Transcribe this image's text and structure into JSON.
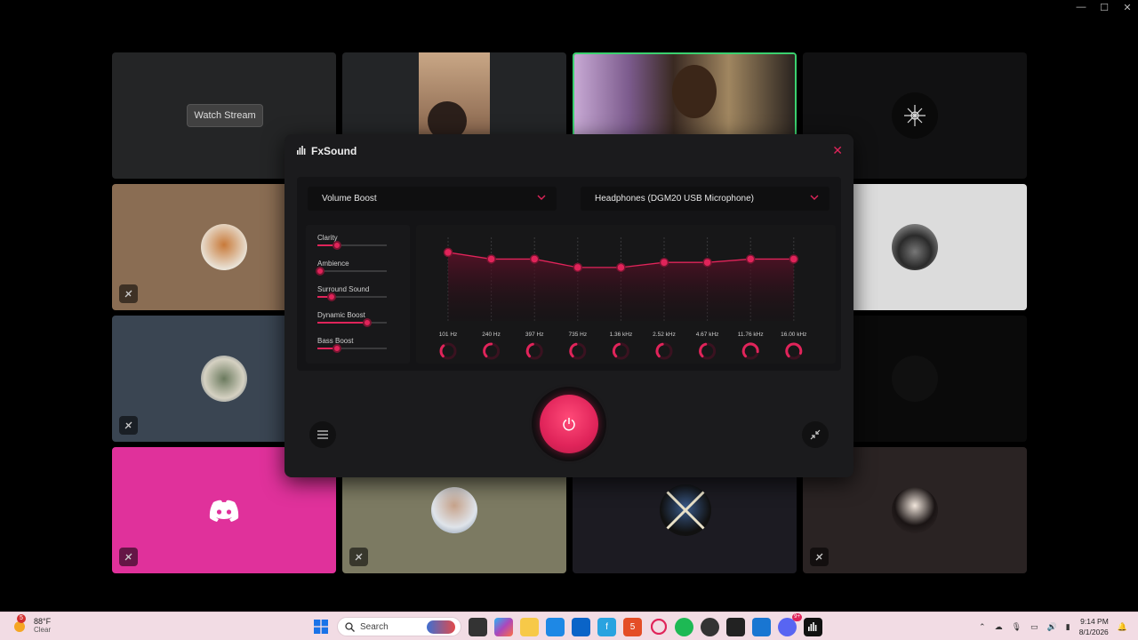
{
  "window_controls": {
    "minimize": "—",
    "maximize": "☐",
    "close": "✕"
  },
  "grid": {
    "watch_stream_label": "Watch Stream"
  },
  "fxsound": {
    "app_name": "FxSound",
    "close_icon": "close-icon",
    "preset": "Volume Boost",
    "output_device": "Headphones (DGM20 USB Microphone)",
    "effects": [
      {
        "label": "Clarity",
        "value": 0.3
      },
      {
        "label": "Ambience",
        "value": 0.0
      },
      {
        "label": "Surround Sound",
        "value": 0.2
      },
      {
        "label": "Dynamic Boost",
        "value": 0.83
      },
      {
        "label": "Bass Boost",
        "value": 0.3
      }
    ],
    "eq_bands": [
      {
        "freq": "101 Hz",
        "level": 0.82
      },
      {
        "freq": "240 Hz",
        "level": 0.74
      },
      {
        "freq": "397 Hz",
        "level": 0.74
      },
      {
        "freq": "735 Hz",
        "level": 0.64
      },
      {
        "freq": "1.36 kHz",
        "level": 0.64
      },
      {
        "freq": "2.52 kHz",
        "level": 0.7
      },
      {
        "freq": "4.67 kHz",
        "level": 0.7
      },
      {
        "freq": "11.76 kHz",
        "level": 0.74
      },
      {
        "freq": "16.00 kHz",
        "level": 0.74
      }
    ],
    "knob_levels": [
      0.35,
      0.5,
      0.45,
      0.45,
      0.45,
      0.45,
      0.45,
      0.85,
      0.9
    ],
    "accent_color": "#e0245a"
  },
  "taskbar": {
    "weather_temp": "88°F",
    "weather_cond": "Clear",
    "weather_badge": "5",
    "search_placeholder": "Search",
    "time": "9:14 PM",
    "date": "8/1/2026",
    "discord_badge": "9+"
  }
}
